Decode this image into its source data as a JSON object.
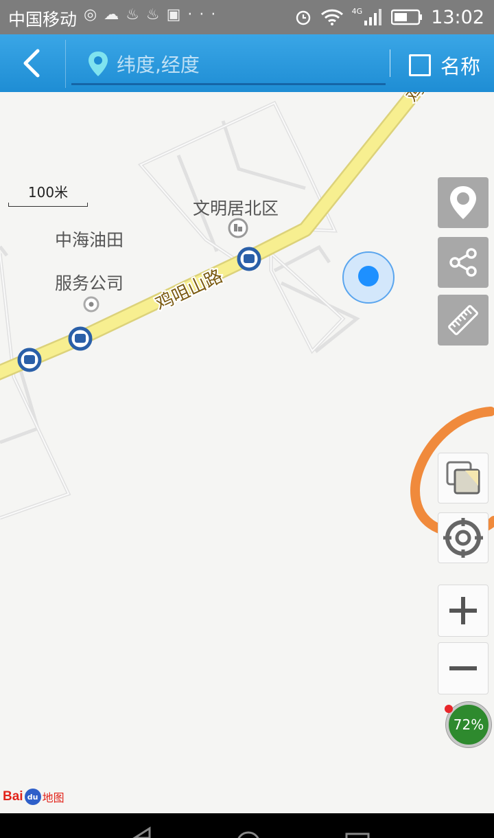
{
  "status_bar": {
    "carrier": "中国移动",
    "notif_icons": "◎☁♨♨▣···",
    "network": "4G",
    "time": "13:02"
  },
  "top_bar": {
    "search_placeholder": "纬度,经度",
    "name_checkbox_label": "名称",
    "name_checked": false
  },
  "map": {
    "scale_label": "100米",
    "road_label": "鸡咀山路",
    "road_label_cut": "鸡",
    "poi_1": "文明居北区",
    "poi_2_line1": "中海油田",
    "poi_2_line2": "服务公司"
  },
  "memory_badge": "72%",
  "logo": {
    "bai": "Bai",
    "du": "du",
    "ditu": "地图"
  },
  "colors": {
    "accent": "#1e8dd4",
    "road": "#f7ef90",
    "location_dot": "#1e90ff",
    "annotation": "#f08a3c",
    "memory_badge": "#2e8a2e"
  },
  "icons": [
    "back-icon",
    "location-pin-icon",
    "checkbox-icon",
    "map-marker-icon",
    "share-icon",
    "ruler-icon",
    "layers-icon",
    "compass-icon",
    "plus-icon",
    "minus-icon",
    "bus-stop-icon",
    "building-icon"
  ]
}
